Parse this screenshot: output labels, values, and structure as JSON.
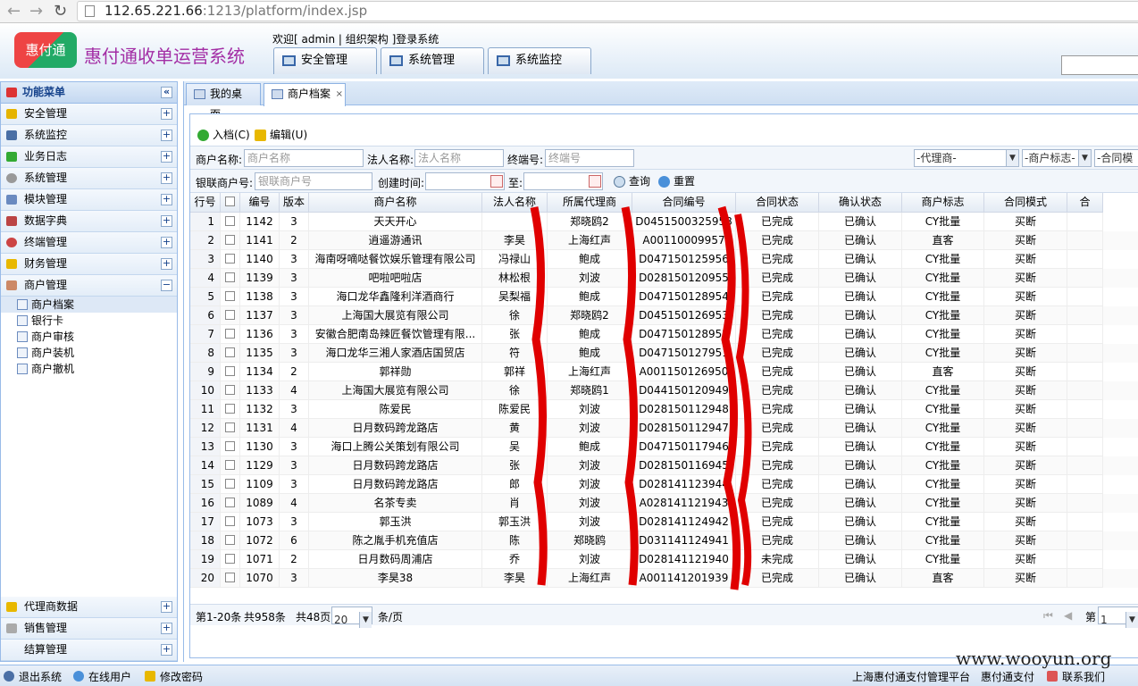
{
  "browser": {
    "url_host": "112.65.221.66",
    "url_rest": ":1213/platform/index.jsp"
  },
  "header": {
    "logo_text": "惠付通",
    "title": "惠付通收单运营系统",
    "welcome": "欢迎[ admin | 组织架构 ]登录系统",
    "tabs": [
      "安全管理",
      "系统管理",
      "系统监控"
    ]
  },
  "sidebar": {
    "title": "功能菜单",
    "items": [
      "安全管理",
      "系统监控",
      "业务日志",
      "系统管理",
      "模块管理",
      "数据字典",
      "终端管理",
      "财务管理",
      "商户管理"
    ],
    "sub_items": [
      "商户档案",
      "银行卡",
      "商户审核",
      "商户装机",
      "商户撤机"
    ],
    "bottom_items": [
      "代理商数据",
      "销售管理",
      "结算管理"
    ],
    "expanded_symbol": "−",
    "collapsed_symbol": "+",
    "collapse_symbol": "«"
  },
  "main_tabs": [
    "我的桌面",
    "商户档案"
  ],
  "toolbar": {
    "add": "入档(C)",
    "edit": "编辑(U)"
  },
  "filters": {
    "merchant_name_label": "商户名称:",
    "merchant_name_ph": "商户名称",
    "legal_name_label": "法人名称:",
    "legal_name_ph": "法人名称",
    "terminal_label": "终端号:",
    "terminal_ph": "终端号",
    "agent_select": "-代理商-",
    "flag_select": "-商户标志-",
    "mode_select": "-合同模式",
    "union_label": "银联商户号:",
    "union_ph": "银联商户号",
    "created_label": "创建时间:",
    "to_label": "至:",
    "query": "查询",
    "reset": "重置"
  },
  "grid": {
    "columns": [
      "行号",
      "",
      "编号",
      "版本",
      "商户名称",
      "法人名称",
      "所属代理商",
      "合同编号",
      "合同状态",
      "确认状态",
      "商户标志",
      "合同模式",
      "合"
    ],
    "rows": [
      [
        "1",
        "1142",
        "3",
        "天天开心",
        "",
        "郑晓鸥2",
        "D0451500325958",
        "已完成",
        "已确认",
        "CY批量",
        "买断"
      ],
      [
        "2",
        "1141",
        "2",
        "逍遥游通讯",
        "李昊",
        "上海红声",
        "A00110009957",
        "已完成",
        "已确认",
        "直客",
        "买断"
      ],
      [
        "3",
        "1140",
        "3",
        "海南呀嘀哒餐饮娱乐管理有限公司",
        "冯禄山",
        "鲍成",
        "D047150125956",
        "已完成",
        "已确认",
        "CY批量",
        "买断"
      ],
      [
        "4",
        "1139",
        "3",
        "吧啦吧啦店",
        "林松根",
        "刘波",
        "D028150120955",
        "已完成",
        "已确认",
        "CY批量",
        "买断"
      ],
      [
        "5",
        "1138",
        "3",
        "海口龙华鑫隆利洋酒商行",
        "吴梨福",
        "鲍成",
        "D047150128954",
        "已完成",
        "已确认",
        "CY批量",
        "买断"
      ],
      [
        "6",
        "1137",
        "3",
        "上海国大展览有限公司",
        "徐",
        "郑晓鸥2",
        "D045150126953",
        "已完成",
        "已确认",
        "CY批量",
        "买断"
      ],
      [
        "7",
        "1136",
        "3",
        "安徽合肥南岛辣匠餐饮管理有限...",
        "张",
        "鲍成",
        "D047150128952",
        "已完成",
        "已确认",
        "CY批量",
        "买断"
      ],
      [
        "8",
        "1135",
        "3",
        "海口龙华三湘人家酒店国贸店",
        "符",
        "鲍成",
        "D047150127951",
        "已完成",
        "已确认",
        "CY批量",
        "买断"
      ],
      [
        "9",
        "1134",
        "2",
        "郭祥勋",
        "郭祥",
        "上海红声",
        "A001150126950",
        "已完成",
        "已确认",
        "直客",
        "买断"
      ],
      [
        "10",
        "1133",
        "4",
        "上海国大展览有限公司",
        "徐",
        "郑晓鸥1",
        "D044150120949",
        "已完成",
        "已确认",
        "CY批量",
        "买断"
      ],
      [
        "11",
        "1132",
        "3",
        "陈爱民",
        "陈爱民",
        "刘波",
        "D028150112948",
        "已完成",
        "已确认",
        "CY批量",
        "买断"
      ],
      [
        "12",
        "1131",
        "4",
        "日月数码跨龙路店",
        "黄",
        "刘波",
        "D028150112947",
        "已完成",
        "已确认",
        "CY批量",
        "买断"
      ],
      [
        "13",
        "1130",
        "3",
        "海口上腾公关策划有限公司",
        "吴",
        "鲍成",
        "D047150117946",
        "已完成",
        "已确认",
        "CY批量",
        "买断"
      ],
      [
        "14",
        "1129",
        "3",
        "日月数码跨龙路店",
        "张",
        "刘波",
        "D028150116945",
        "已完成",
        "已确认",
        "CY批量",
        "买断"
      ],
      [
        "15",
        "1109",
        "3",
        "日月数码跨龙路店",
        "郎",
        "刘波",
        "D028141123944",
        "已完成",
        "已确认",
        "CY批量",
        "买断"
      ],
      [
        "16",
        "1089",
        "4",
        "名茶专卖",
        "肖",
        "刘波",
        "A028141121943",
        "已完成",
        "已确认",
        "CY批量",
        "买断"
      ],
      [
        "17",
        "1073",
        "3",
        "郭玉洪",
        "郭玉洪",
        "刘波",
        "D028141124942",
        "已完成",
        "已确认",
        "CY批量",
        "买断"
      ],
      [
        "18",
        "1072",
        "6",
        "陈之胤手机充值店",
        "陈",
        "郑晓鸥",
        "D031141124941",
        "已完成",
        "已确认",
        "CY批量",
        "买断"
      ],
      [
        "19",
        "1071",
        "2",
        "日月数码周浦店",
        "乔",
        "刘波",
        "D028141121940",
        "未完成",
        "已确认",
        "CY批量",
        "买断"
      ],
      [
        "20",
        "1070",
        "3",
        "李昊38",
        "李昊",
        "上海红声",
        "A001141201939",
        "已完成",
        "已确认",
        "直客",
        "买断"
      ]
    ]
  },
  "pager": {
    "range": "第1-20条",
    "total": "共958条",
    "pages": "共48页",
    "page_size": "20",
    "per_page": "条/页",
    "page_label": "第",
    "page_value": "1",
    "first": "⏮",
    "prev": "◀"
  },
  "statusbar": {
    "logout": "退出系统",
    "online": "在线用户",
    "password": "修改密码",
    "platform": "上海惠付通支付管理平台",
    "company": "惠付通支付",
    "contact": "联系我们"
  },
  "watermark": "www.wooyun.org",
  "colors": {
    "title": "#a32ea5",
    "accent": "#15428b",
    "redaction": "#e00000"
  }
}
